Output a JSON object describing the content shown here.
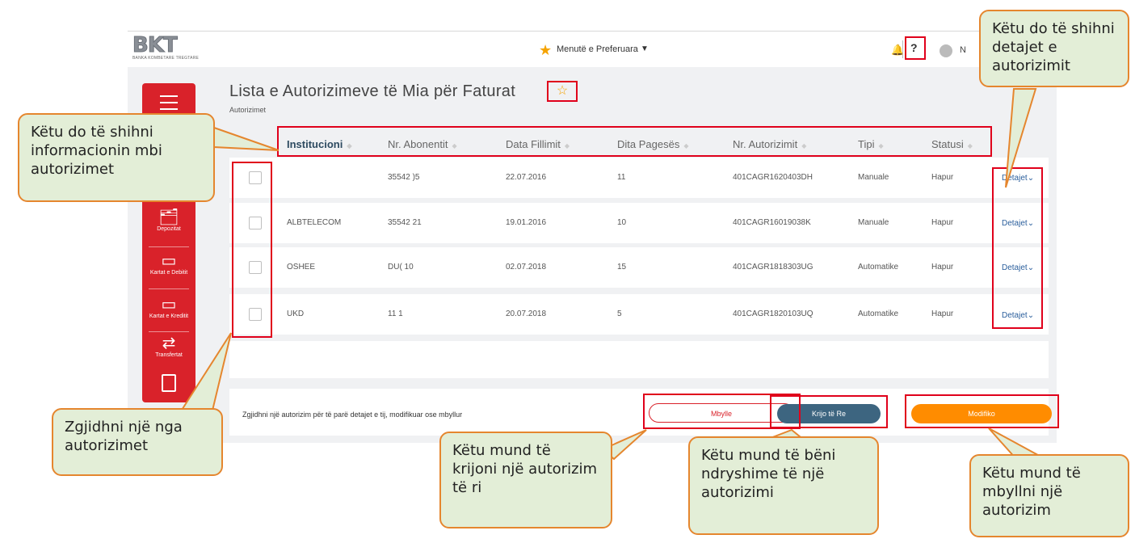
{
  "topbar": {
    "logo_text": "BKT",
    "logo_subtitle": "BANKA KOMBETARE TREGTARE",
    "favorites_label": "Menutë e Preferuara",
    "help_label": "?",
    "user_initial": "N"
  },
  "sidebar": {
    "items": [
      {
        "label": "Depozitat",
        "icon": "deposit-icon"
      },
      {
        "label": "Kartat e Debitit",
        "icon": "debit-card-icon"
      },
      {
        "label": "Kartat e Kreditit",
        "icon": "credit-card-icon"
      },
      {
        "label": "Transfertat",
        "icon": "transfer-icon"
      }
    ]
  },
  "page": {
    "title": "Lista e Autorizimeve të Mia për Faturat",
    "breadcrumb": "Autorizimet"
  },
  "table": {
    "columns": [
      "Institucioni",
      "Nr. Abonentit",
      "Data Fillimit",
      "Dita Pagesës",
      "Nr. Autorizimit",
      "Tipi",
      "Statusi"
    ],
    "rows": [
      {
        "institucioni": "",
        "abonent": "35542  )5",
        "data": "22.07.2016",
        "dita": "11",
        "autorizim": "401CAGR1620403DH",
        "tipi": "Manuale",
        "statusi": "Hapur",
        "detaje": "Detajet"
      },
      {
        "institucioni": "ALBTELECOM",
        "abonent": "35542  21",
        "data": "19.01.2016",
        "dita": "10",
        "autorizim": "401CAGR16019038K",
        "tipi": "Manuale",
        "statusi": "Hapur",
        "detaje": "Detajet"
      },
      {
        "institucioni": "OSHEE",
        "abonent": "DU(            10",
        "data": "02.07.2018",
        "dita": "15",
        "autorizim": "401CAGR1818303UG",
        "tipi": "Automatike",
        "statusi": "Hapur",
        "detaje": "Detajet"
      },
      {
        "institucioni": "UKD",
        "abonent": "11    1",
        "data": "20.07.2018",
        "dita": "5",
        "autorizim": "401CAGR1820103UQ",
        "tipi": "Automatike",
        "statusi": "Hapur",
        "detaje": "Detajet"
      }
    ]
  },
  "footer": {
    "hint": "Zgjidhni një autorizim për të parë detajet e tij, modifikuar ose mbyllur",
    "btn_mbylle": "Mbylle",
    "btn_krijo": "Krijo të Re",
    "btn_modifiko": "Modifiko"
  },
  "callouts": {
    "top_right": "Këtu do të shihni detajet e autorizimit",
    "info": "Këtu do të shihni informacionin mbi autorizimet",
    "select": "Zgjidhni një nga autorizimet",
    "create": "Këtu mund të krijoni një autorizim të ri",
    "modify": "Këtu mund të bëni ndryshime të një autorizimi",
    "close": "Këtu mund të mbyllni një autorizim"
  },
  "colors": {
    "brand_red": "#d9222a",
    "highlight_red": "#e0001b",
    "callout_fill": "#e3eed7",
    "callout_border": "#e5862e",
    "accent_orange": "#ff8c00",
    "button_blue": "#3d6580"
  }
}
